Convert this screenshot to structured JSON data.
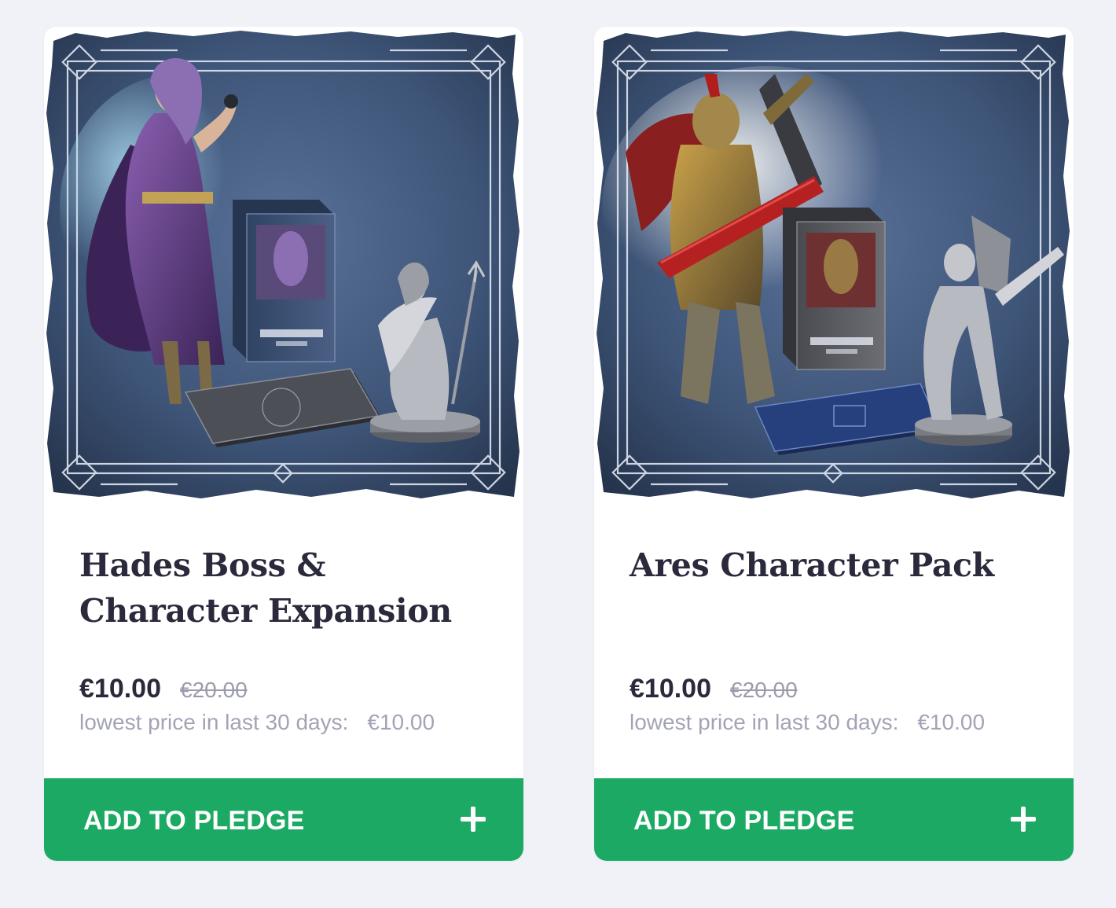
{
  "colors": {
    "page_background": "#f1f2f7",
    "card_background": "#ffffff",
    "button_green": "#1ca963",
    "title_text": "#2b2a3c",
    "muted_text": "#a2a4b5",
    "art_background": "#3e5578"
  },
  "products": [
    {
      "title": "Hades Boss & Character Expansion",
      "image_icon": "hades-character-pack-image",
      "price": "€10.00",
      "original_price": "€20.00",
      "lowest_price_label": "lowest price in last 30 days:",
      "lowest_price_value": "€10.00",
      "button_label": "ADD TO PLEDGE",
      "button_icon": "plus-icon"
    },
    {
      "title": "Ares Character Pack",
      "image_icon": "ares-character-pack-image",
      "price": "€10.00",
      "original_price": "€20.00",
      "lowest_price_label": "lowest price in last 30 days:",
      "lowest_price_value": "€10.00",
      "button_label": "ADD TO PLEDGE",
      "button_icon": "plus-icon"
    }
  ]
}
